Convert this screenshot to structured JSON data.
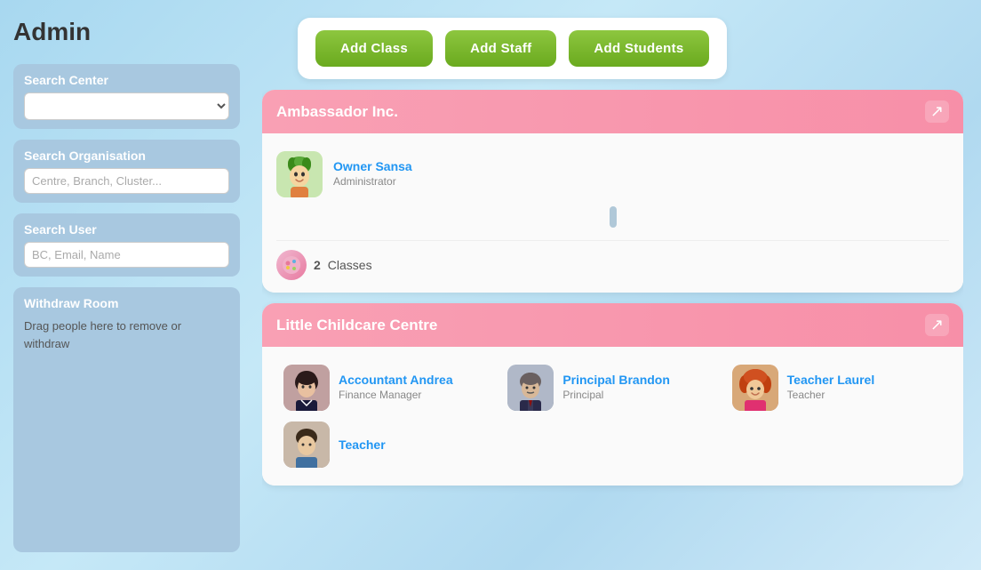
{
  "page": {
    "title": "Admin"
  },
  "sidebar": {
    "search_center_label": "Search Center",
    "search_center_placeholder": "",
    "search_org_label": "Search Organisation",
    "search_org_placeholder": "Centre, Branch, Cluster...",
    "search_user_label": "Search User",
    "search_user_placeholder": "BC, Email, Name",
    "withdraw_label": "Withdraw Room",
    "withdraw_text": "Drag people here to remove or withdraw"
  },
  "toolbar": {
    "add_class_label": "Add Class",
    "add_staff_label": "Add Staff",
    "add_students_label": "Add Students"
  },
  "organizations": [
    {
      "id": "ambassador",
      "name": "Ambassador Inc.",
      "members": [
        {
          "name": "Owner Sansa",
          "role": "Administrator",
          "avatar_type": "owner"
        }
      ],
      "classes_count": "2",
      "classes_label": "Classes"
    },
    {
      "id": "little-childcare",
      "name": "Little Childcare Centre",
      "members": [
        {
          "name": "Accountant Andrea",
          "role": "Finance Manager",
          "avatar_type": "accountant"
        },
        {
          "name": "Principal Brandon",
          "role": "Principal",
          "avatar_type": "principal"
        },
        {
          "name": "Teacher Laurel",
          "role": "Teacher",
          "avatar_type": "teacher-laurel"
        }
      ],
      "more_members": [
        {
          "name": "Teacher",
          "role": "",
          "avatar_type": "teacher-bottom"
        }
      ]
    }
  ],
  "icons": {
    "export": "↗",
    "classes": "🎨",
    "dropdown_arrow": "▾"
  }
}
